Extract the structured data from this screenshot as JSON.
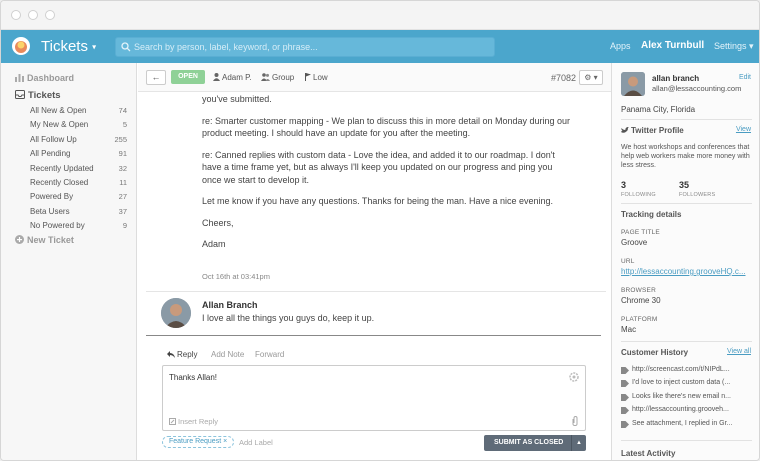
{
  "app": {
    "title": "Tickets",
    "title_caret": "▾"
  },
  "search": {
    "placeholder": "Search by person, label, keyword, or phrase..."
  },
  "header": {
    "apps_label": "Apps",
    "user_name": "Alex Turnbull",
    "settings_label": "Settings ▾"
  },
  "sidebar": {
    "dashboard_label": "Dashboard",
    "tickets_label": "Tickets",
    "items": [
      {
        "label": "All New & Open",
        "count": "74"
      },
      {
        "label": "My New & Open",
        "count": "5"
      },
      {
        "label": "All Follow Up",
        "count": "255"
      },
      {
        "label": "All Pending",
        "count": "91"
      },
      {
        "label": "Recently Updated",
        "count": "32"
      },
      {
        "label": "Recently Closed",
        "count": "11"
      },
      {
        "label": "Powered By",
        "count": "27"
      },
      {
        "label": "Beta Users",
        "count": "37"
      },
      {
        "label": "No Powered by",
        "count": "9"
      }
    ],
    "new_ticket_label": "New Ticket"
  },
  "toolbar": {
    "back_label": "←",
    "status": "OPEN",
    "assignee": "Adam P.",
    "group": "Group",
    "priority": "Low",
    "ticket_number": "#7082",
    "gear_label": "⚙ ▾"
  },
  "thread": {
    "paragraphs": [
      "you've submitted.",
      "re: Smarter customer mapping - We plan to discuss this in more detail on Monday during our product meeting. I should have an update for you after the meeting.",
      "re: Canned replies with custom data - Love the idea, and added it to our roadmap. I don't have a time frame yet, but as always I'll keep you updated on our progress and ping you once we start to develop it.",
      "Let me know if you have any questions. Thanks for being the man. Have a nice evening.",
      "Cheers,",
      "Adam"
    ],
    "timestamp": "Oct 16th at 03:41pm",
    "reply": {
      "author": "Allan Branch",
      "text": "I love all the things you guys do, keep it up."
    }
  },
  "composer": {
    "tabs": {
      "reply": "Reply",
      "add_note": "Add Note",
      "forward": "Forward"
    },
    "body": "Thanks Allan!",
    "insert_reply": "Insert Reply",
    "tag": "Feature Request ×",
    "add_label": "Add Label",
    "submit": "SUBMIT AS CLOSED",
    "submit_caret": "▲"
  },
  "customer": {
    "name": "allan branch",
    "email": "allan@lessaccounting.com",
    "edit_label": "Edit",
    "location": "Panama City, Florida",
    "twitter_heading": "Twitter Profile",
    "twitter_view": "View",
    "bio": "We host workshops and conferences that help web workers make more money with less stress.",
    "following_count": "3",
    "following_label": "FOLLOWING",
    "followers_count": "35",
    "followers_label": "FOLLOWERS",
    "tracking_heading": "Tracking details",
    "page_title_key": "PAGE TITLE",
    "page_title_val": "Groove",
    "url_key": "URL",
    "url_val": "http://lessaccounting.grooveHQ.c...",
    "browser_key": "BROWSER",
    "browser_val": "Chrome 30",
    "platform_key": "PLATFORM",
    "platform_val": "Mac",
    "history_heading": "Customer History",
    "history_view_all": "View all",
    "history": [
      "http://screencast.com/t/NIPdL...",
      "I'd love to inject custom data (...",
      "Looks like there's new email n...",
      "http://lessaccounting.grooveh...",
      "See attachment, I replied in Gr..."
    ],
    "activity_heading": "Latest Activity"
  },
  "colors": {
    "topbar": "#4ba6cc",
    "accent": "#4a9cc2",
    "open_badge": "#8fd197",
    "submit": "#5f6b78"
  }
}
